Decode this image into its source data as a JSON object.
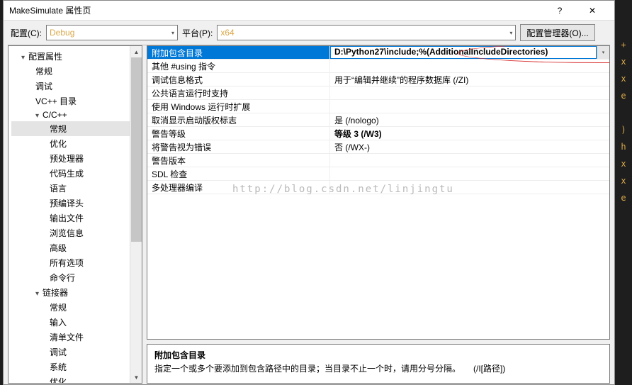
{
  "title": "MakeSimulate 属性页",
  "helpGlyph": "?",
  "closeGlyph": "✕",
  "toolbar": {
    "cfgLabel": "配置(C):",
    "cfgValue": "Debug",
    "platLabel": "平台(P):",
    "platValue": "x64",
    "mgrLabel": "配置管理器(O)..."
  },
  "tree": [
    {
      "l": 1,
      "t": "配置属性",
      "c": "▾"
    },
    {
      "l": 2,
      "t": "常规"
    },
    {
      "l": 2,
      "t": "调试"
    },
    {
      "l": 2,
      "t": "VC++ 目录"
    },
    {
      "l": 2,
      "t": "C/C++",
      "c": "▾"
    },
    {
      "l": 3,
      "t": "常规",
      "sel": true
    },
    {
      "l": 3,
      "t": "优化"
    },
    {
      "l": 3,
      "t": "预处理器"
    },
    {
      "l": 3,
      "t": "代码生成"
    },
    {
      "l": 3,
      "t": "语言"
    },
    {
      "l": 3,
      "t": "预编译头"
    },
    {
      "l": 3,
      "t": "输出文件"
    },
    {
      "l": 3,
      "t": "浏览信息"
    },
    {
      "l": 3,
      "t": "高级"
    },
    {
      "l": 3,
      "t": "所有选项"
    },
    {
      "l": 3,
      "t": "命令行"
    },
    {
      "l": 2,
      "t": "链接器",
      "c": "▾"
    },
    {
      "l": 3,
      "t": "常规"
    },
    {
      "l": 3,
      "t": "输入"
    },
    {
      "l": 3,
      "t": "清单文件"
    },
    {
      "l": 3,
      "t": "调试"
    },
    {
      "l": 3,
      "t": "系统"
    },
    {
      "l": 3,
      "t": "优化"
    }
  ],
  "grid": [
    {
      "k": "附加包含目录",
      "v": "D:\\Python27\\include;%(AdditionalIncludeDirectories)",
      "sel": true,
      "drop": true
    },
    {
      "k": "其他 #using 指令",
      "v": ""
    },
    {
      "k": "调试信息格式",
      "v": "用于“编辑并继续”的程序数据库 (/ZI)"
    },
    {
      "k": "公共语言运行时支持",
      "v": ""
    },
    {
      "k": "使用 Windows 运行时扩展",
      "v": ""
    },
    {
      "k": "取消显示启动版权标志",
      "v": "是 (/nologo)"
    },
    {
      "k": "警告等级",
      "v": "等级 3 (/W3)",
      "bold": true
    },
    {
      "k": "将警告视为错误",
      "v": "否 (/WX-)"
    },
    {
      "k": "警告版本",
      "v": ""
    },
    {
      "k": "SDL 检查",
      "v": ""
    },
    {
      "k": "多处理器编译",
      "v": ""
    }
  ],
  "watermark": "http://blog.csdn.net/linjingtu",
  "desc": {
    "title": "附加包含目录",
    "body": "指定一个或多个要添加到包含路径中的目录；当目录不止一个时，请用分号分隔。　　(/I[路径])"
  },
  "code": [
    "+",
    "x",
    "x",
    "e",
    "",
    ")",
    "h",
    "x",
    "x",
    "e"
  ]
}
